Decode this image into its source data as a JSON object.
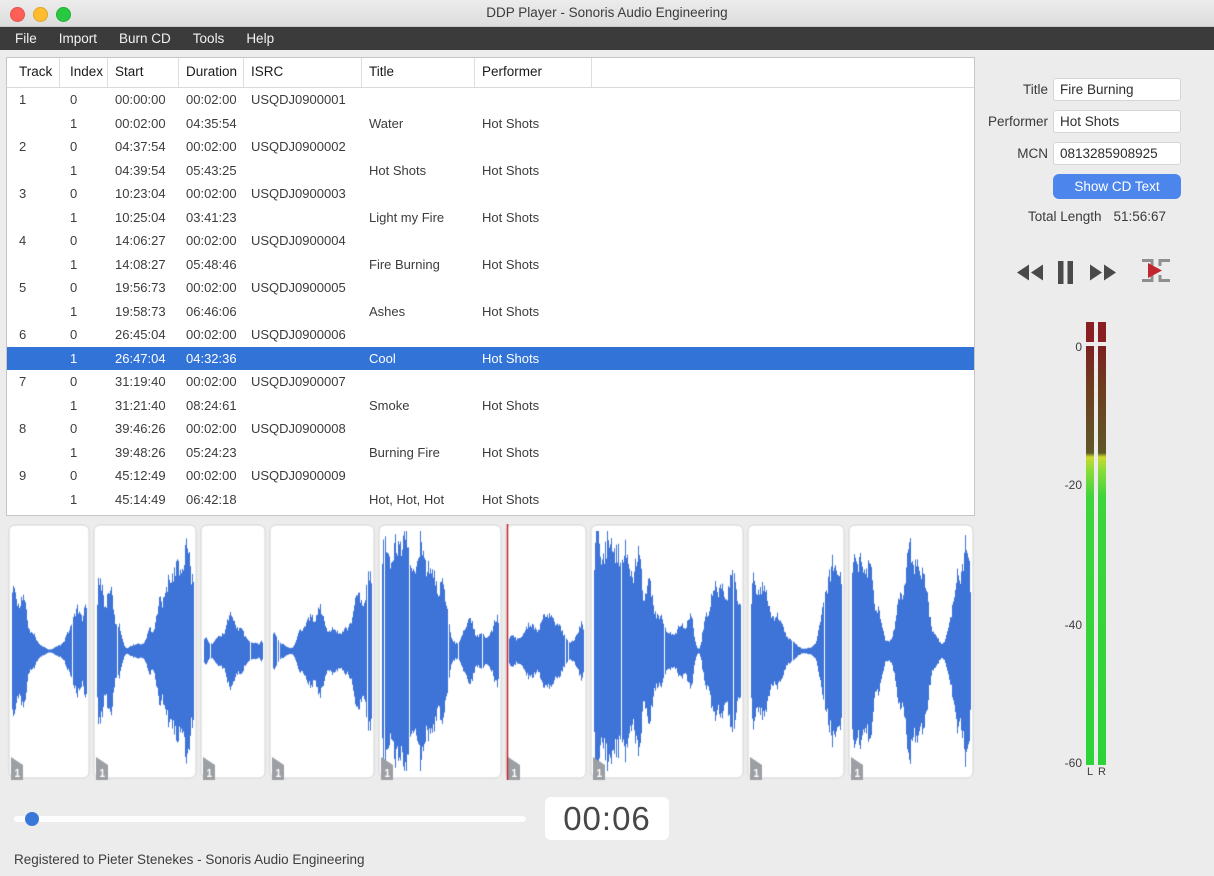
{
  "window": {
    "title": "DDP Player - Sonoris Audio Engineering"
  },
  "menu": {
    "items": [
      "File",
      "Import",
      "Burn CD",
      "Tools",
      "Help"
    ]
  },
  "table": {
    "columns": [
      "Track",
      "Index",
      "Start",
      "Duration",
      "ISRC",
      "Title",
      "Performer"
    ],
    "rows": [
      {
        "track": "1",
        "index": "0",
        "start": "00:00:00",
        "duration": "00:02:00",
        "isrc": "USQDJ0900001",
        "title": "",
        "performer": "",
        "selected": false
      },
      {
        "track": "",
        "index": "1",
        "start": "00:02:00",
        "duration": "04:35:54",
        "isrc": "",
        "title": "Water",
        "performer": "Hot Shots",
        "selected": false
      },
      {
        "track": "2",
        "index": "0",
        "start": "04:37:54",
        "duration": "00:02:00",
        "isrc": "USQDJ0900002",
        "title": "",
        "performer": "",
        "selected": false
      },
      {
        "track": "",
        "index": "1",
        "start": "04:39:54",
        "duration": "05:43:25",
        "isrc": "",
        "title": "Hot Shots",
        "performer": "Hot Shots",
        "selected": false
      },
      {
        "track": "3",
        "index": "0",
        "start": "10:23:04",
        "duration": "00:02:00",
        "isrc": "USQDJ0900003",
        "title": "",
        "performer": "",
        "selected": false
      },
      {
        "track": "",
        "index": "1",
        "start": "10:25:04",
        "duration": "03:41:23",
        "isrc": "",
        "title": "Light my Fire",
        "performer": "Hot Shots",
        "selected": false
      },
      {
        "track": "4",
        "index": "0",
        "start": "14:06:27",
        "duration": "00:02:00",
        "isrc": "USQDJ0900004",
        "title": "",
        "performer": "",
        "selected": false
      },
      {
        "track": "",
        "index": "1",
        "start": "14:08:27",
        "duration": "05:48:46",
        "isrc": "",
        "title": "Fire Burning",
        "performer": "Hot Shots",
        "selected": false
      },
      {
        "track": "5",
        "index": "0",
        "start": "19:56:73",
        "duration": "00:02:00",
        "isrc": "USQDJ0900005",
        "title": "",
        "performer": "",
        "selected": false
      },
      {
        "track": "",
        "index": "1",
        "start": "19:58:73",
        "duration": "06:46:06",
        "isrc": "",
        "title": "Ashes",
        "performer": "Hot Shots",
        "selected": false
      },
      {
        "track": "6",
        "index": "0",
        "start": "26:45:04",
        "duration": "00:02:00",
        "isrc": "USQDJ0900006",
        "title": "",
        "performer": "",
        "selected": false
      },
      {
        "track": "",
        "index": "1",
        "start": "26:47:04",
        "duration": "04:32:36",
        "isrc": "",
        "title": "Cool",
        "performer": "Hot Shots",
        "selected": true
      },
      {
        "track": "7",
        "index": "0",
        "start": "31:19:40",
        "duration": "00:02:00",
        "isrc": "USQDJ0900007",
        "title": "",
        "performer": "",
        "selected": false
      },
      {
        "track": "",
        "index": "1",
        "start": "31:21:40",
        "duration": "08:24:61",
        "isrc": "",
        "title": "Smoke",
        "performer": "Hot Shots",
        "selected": false
      },
      {
        "track": "8",
        "index": "0",
        "start": "39:46:26",
        "duration": "00:02:00",
        "isrc": "USQDJ0900008",
        "title": "",
        "performer": "",
        "selected": false
      },
      {
        "track": "",
        "index": "1",
        "start": "39:48:26",
        "duration": "05:24:23",
        "isrc": "",
        "title": "Burning Fire",
        "performer": "Hot Shots",
        "selected": false
      },
      {
        "track": "9",
        "index": "0",
        "start": "45:12:49",
        "duration": "00:02:00",
        "isrc": "USQDJ0900009",
        "title": "",
        "performer": "",
        "selected": false
      },
      {
        "track": "",
        "index": "1",
        "start": "45:14:49",
        "duration": "06:42:18",
        "isrc": "",
        "title": "Hot, Hot, Hot",
        "performer": "Hot Shots",
        "selected": false
      }
    ]
  },
  "side": {
    "title_label": "Title",
    "title_value": "Fire Burning",
    "performer_label": "Performer",
    "performer_value": "Hot Shots",
    "mcn_label": "MCN",
    "mcn_value": "0813285908925",
    "show_cd_text_label": "Show CD Text",
    "total_length_label": "Total Length",
    "total_length_value": "51:56:67"
  },
  "transport": {
    "icons": [
      "rewind-icon",
      "pause-icon",
      "fast-forward-icon",
      "play-range-icon"
    ]
  },
  "meter": {
    "ticks": [
      "0",
      "-20",
      "-40",
      "-60"
    ],
    "channels": [
      "L",
      "R"
    ]
  },
  "player": {
    "time": "00:06"
  },
  "status": {
    "text": "Registered to Pieter Stenekes - Sonoris Audio Engineering"
  },
  "waveform": {
    "segment_fracs": [
      0.0016,
      0.0897,
      0.2005,
      0.2722,
      0.3847,
      0.5156,
      0.6037,
      0.7662,
      0.8709
    ],
    "end_frac": 1.0,
    "cursor_frac": 0.5175,
    "marker_label": "1",
    "colors": {
      "wave": "#3e73d8",
      "cursor": "#c2252e",
      "marker": "#9c9fa3",
      "selection": "#3273d8",
      "accent": "#4c86ec"
    }
  }
}
